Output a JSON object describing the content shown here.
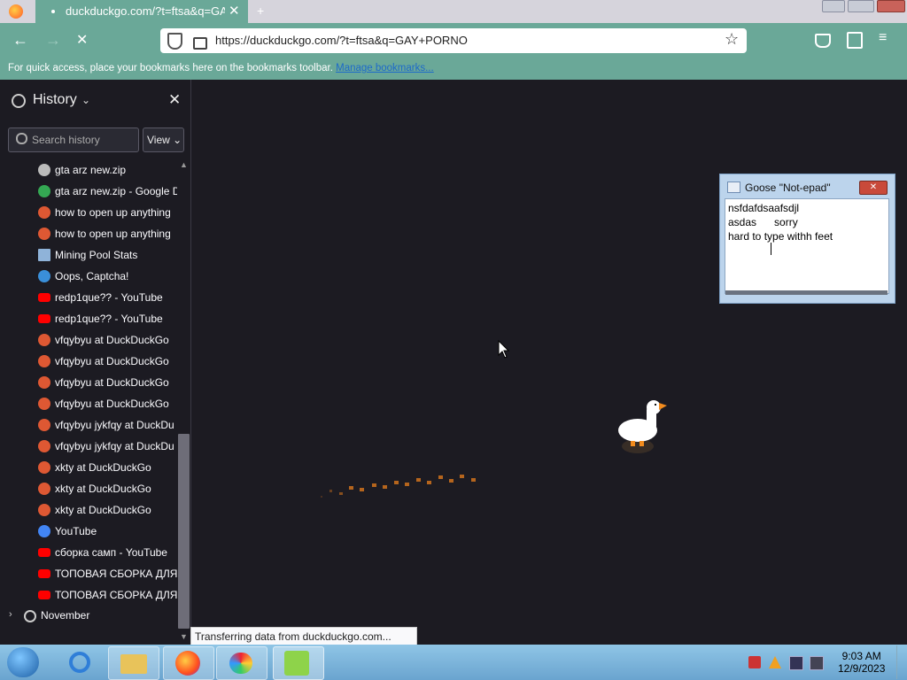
{
  "browser": {
    "tab_title": "duckduckgo.com/?t=ftsa&q=GAY",
    "url": "https://duckduckgo.com/?t=ftsa&q=GAY+PORNO",
    "bookmarks_hint": "For quick access, place your bookmarks here on the bookmarks toolbar.",
    "bookmarks_link": "Manage bookmarks...",
    "status": "Transferring data from duckduckgo.com..."
  },
  "sidebar": {
    "title": "History",
    "search_placeholder": "Search history",
    "view_label": "View",
    "items": [
      {
        "label": "gta arz new.zip",
        "icon": "globe-icon",
        "color": "#bbbbbb"
      },
      {
        "label": "gta arz new.zip - Google D",
        "icon": "google-drive-icon",
        "color": "#34a853"
      },
      {
        "label": "how to open up anything",
        "icon": "duckduckgo-icon",
        "color": "#de5833"
      },
      {
        "label": "how to open up anything",
        "icon": "duckduckgo-icon",
        "color": "#de5833"
      },
      {
        "label": "Mining Pool Stats",
        "icon": "mining-pool-icon",
        "color": "#8fb3d9"
      },
      {
        "label": "Oops, Captcha!",
        "icon": "captcha-icon",
        "color": "#3a8fd9"
      },
      {
        "label": "redp1que?? - YouTube",
        "icon": "youtube-icon",
        "color": "#ff0000"
      },
      {
        "label": "redp1que?? - YouTube",
        "icon": "youtube-icon",
        "color": "#ff0000"
      },
      {
        "label": "vfqybyu at DuckDuckGo",
        "icon": "duckduckgo-icon",
        "color": "#de5833"
      },
      {
        "label": "vfqybyu at DuckDuckGo",
        "icon": "duckduckgo-icon",
        "color": "#de5833"
      },
      {
        "label": "vfqybyu at DuckDuckGo",
        "icon": "duckduckgo-icon",
        "color": "#de5833"
      },
      {
        "label": "vfqybyu at DuckDuckGo",
        "icon": "duckduckgo-icon",
        "color": "#de5833"
      },
      {
        "label": "vfqybyu jykfqy at DuckDu",
        "icon": "duckduckgo-icon",
        "color": "#de5833"
      },
      {
        "label": "vfqybyu jykfqy at DuckDu",
        "icon": "duckduckgo-icon",
        "color": "#de5833"
      },
      {
        "label": "xkty at DuckDuckGo",
        "icon": "duckduckgo-icon",
        "color": "#de5833"
      },
      {
        "label": "xkty at DuckDuckGo",
        "icon": "duckduckgo-icon",
        "color": "#de5833"
      },
      {
        "label": "xkty at DuckDuckGo",
        "icon": "duckduckgo-icon",
        "color": "#de5833"
      },
      {
        "label": "YouTube",
        "icon": "google-icon",
        "color": "#4285f4"
      },
      {
        "label": "сборка самп - YouTube",
        "icon": "youtube-icon",
        "color": "#ff0000"
      },
      {
        "label": "ТОПОВАЯ СБОРКА ДЛЯ ...",
        "icon": "youtube-icon",
        "color": "#ff0000"
      },
      {
        "label": "ТОПОВАЯ СБОРКА ДЛЯ ...",
        "icon": "youtube-icon",
        "color": "#ff0000"
      }
    ],
    "group": "November"
  },
  "notepad": {
    "title": "Goose \"Not-epad\"",
    "close_label": "✕",
    "lines": [
      "nsfdafdsaafsdjl",
      "asdas      sorry",
      "hard to type withh feet"
    ]
  },
  "taskbar": {
    "time": "9:03 AM",
    "date": "12/9/2023",
    "icons": [
      "start-orb-icon",
      "internet-explorer-icon",
      "file-explorer-icon",
      "firefox-icon",
      "paint-icon",
      "desktop-goose-icon"
    ]
  }
}
